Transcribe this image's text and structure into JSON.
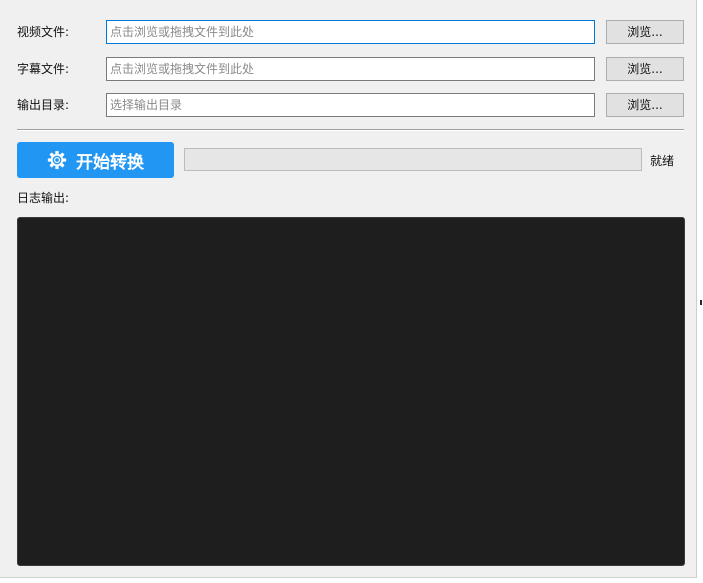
{
  "rows": {
    "video": {
      "label": "视频文件:",
      "value": "",
      "placeholder": "点击浏览或拖拽文件到此处",
      "browse_label": "浏览..."
    },
    "subtitle": {
      "label": "字幕文件:",
      "value": "",
      "placeholder": "点击浏览或拖拽文件到此处",
      "browse_label": "浏览..."
    },
    "output": {
      "label": "输出目录:",
      "value": "",
      "placeholder": "选择输出目录",
      "browse_label": "浏览..."
    }
  },
  "action": {
    "start_label": "开始转换",
    "start_icon": "gear-icon",
    "progress_percent": 0,
    "status_text": "就绪"
  },
  "log": {
    "label": "日志输出:",
    "content": ""
  },
  "colors": {
    "accent": "#2196f3",
    "log_background": "#1e1e1e",
    "window_background": "#f0f0f0"
  }
}
